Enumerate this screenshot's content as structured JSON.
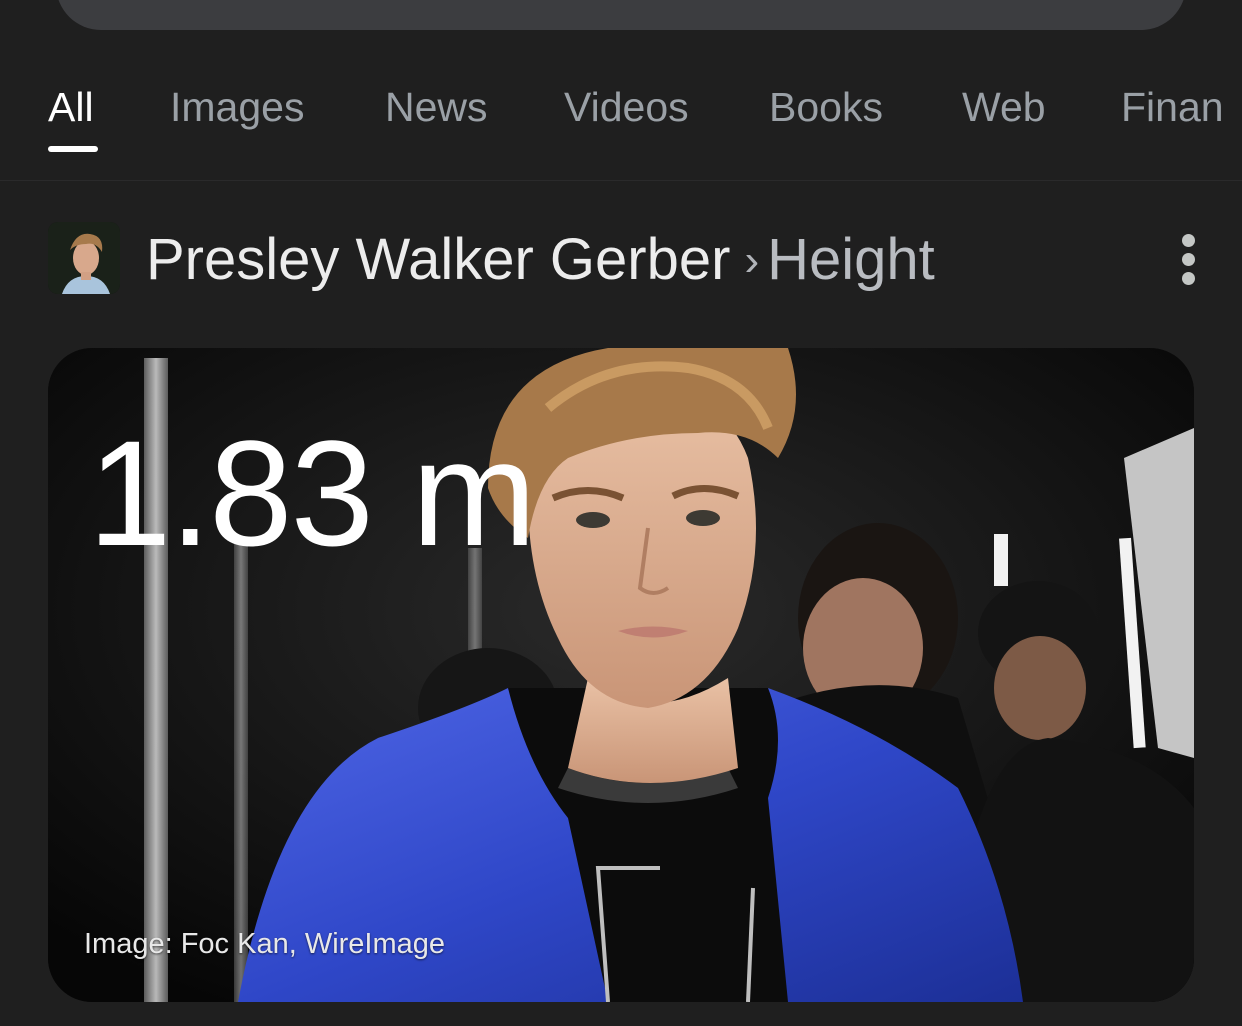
{
  "tabs": [
    {
      "label": "All",
      "active": true
    },
    {
      "label": "Images",
      "active": false
    },
    {
      "label": "News",
      "active": false
    },
    {
      "label": "Videos",
      "active": false
    },
    {
      "label": "Books",
      "active": false
    },
    {
      "label": "Web",
      "active": false
    },
    {
      "label": "Finan",
      "active": false
    }
  ],
  "result": {
    "entity": "Presley Walker Gerber",
    "separator": "›",
    "attribute": "Height",
    "menu_icon": "more-vert-icon"
  },
  "card": {
    "height_value": "1.83 m",
    "image_credit": "Image: Foc Kan, WireImage"
  },
  "colors": {
    "background": "#1f1f1f",
    "tab_active": "#ffffff",
    "tab_inactive": "#9aa0a6",
    "jacket_blue": "#2f47c8"
  }
}
